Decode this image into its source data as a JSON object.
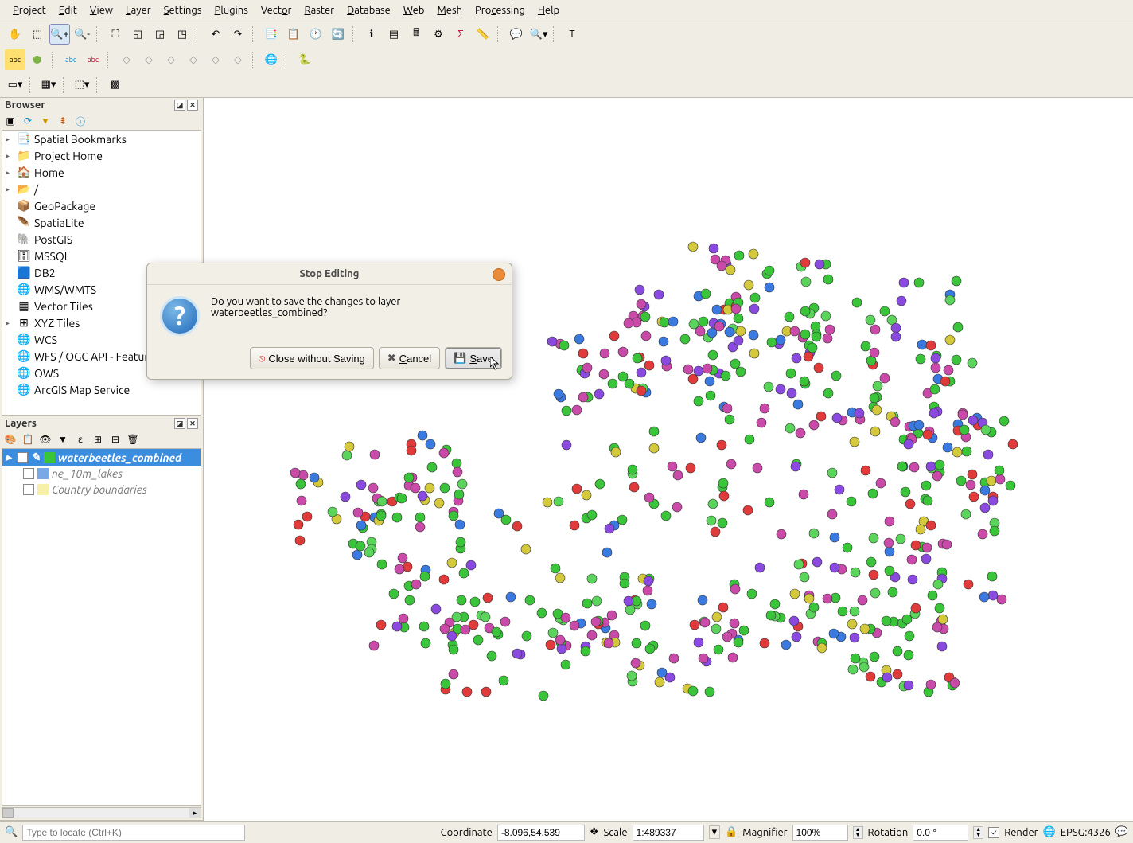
{
  "menu": [
    "Project",
    "Edit",
    "View",
    "Layer",
    "Settings",
    "Plugins",
    "Vector",
    "Raster",
    "Database",
    "Web",
    "Mesh",
    "Processing",
    "Help"
  ],
  "panels": {
    "browser_title": "Browser",
    "layers_title": "Layers",
    "browser_items": [
      {
        "icon": "📑",
        "label": "Spatial Bookmarks",
        "exp": true
      },
      {
        "icon": "📁",
        "label": "Project Home",
        "exp": true
      },
      {
        "icon": "🏠",
        "label": "Home",
        "exp": true
      },
      {
        "icon": "📂",
        "label": "/",
        "exp": true
      },
      {
        "icon": "📦",
        "label": "GeoPackage",
        "exp": false
      },
      {
        "icon": "🪶",
        "label": "SpatiaLite",
        "exp": false
      },
      {
        "icon": "🐘",
        "label": "PostGIS",
        "exp": false
      },
      {
        "icon": "🗄",
        "label": "MSSQL",
        "exp": false
      },
      {
        "icon": "🟦",
        "label": "DB2",
        "exp": false
      },
      {
        "icon": "🌐",
        "label": "WMS/WMTS",
        "exp": false
      },
      {
        "icon": "▦",
        "label": "Vector Tiles",
        "exp": false
      },
      {
        "icon": "⊞",
        "label": "XYZ Tiles",
        "exp": true
      },
      {
        "icon": "🌐",
        "label": "WCS",
        "exp": false
      },
      {
        "icon": "🌐",
        "label": "WFS / OGC API - Features",
        "exp": false
      },
      {
        "icon": "🌐",
        "label": "OWS",
        "exp": false
      },
      {
        "icon": "🌐",
        "label": "ArcGIS Map Service",
        "exp": false
      }
    ]
  },
  "layers": [
    {
      "checked": true,
      "name": "waterbeetles_combined",
      "selected": true,
      "editing": true,
      "color": "#3ac43a"
    },
    {
      "checked": false,
      "name": "ne_10m_lakes",
      "color": "#7aa8e6",
      "italic": true
    },
    {
      "checked": false,
      "name": "Country boundaries",
      "color": "#f6f0a8",
      "italic": true
    }
  ],
  "dialog": {
    "title": "Stop Editing",
    "message_l1": "Do you want to save the changes to layer",
    "message_l2": "waterbeetles_combined?",
    "btn_close": "Close without Saving",
    "btn_cancel": "Cancel",
    "btn_save": "Save"
  },
  "status": {
    "locate_placeholder": "Type to locate (Ctrl+K)",
    "coord_label": "Coordinate",
    "coord_value": "-8.096,54.539",
    "scale_label": "Scale",
    "scale_value": "1:489337",
    "magnifier_label": "Magnifier",
    "magnifier_value": "100%",
    "rotation_label": "Rotation",
    "rotation_value": "0.0 °",
    "render_label": "Render",
    "crs_label": "EPSG:4326"
  },
  "point_colors": [
    "#3ac43a",
    "#3ac43a",
    "#3ac43a",
    "#c94aa8",
    "#c94aa8",
    "#5bd45b",
    "#d4c93a",
    "#e03a3a",
    "#3a7ae0",
    "#8a4ae0"
  ]
}
